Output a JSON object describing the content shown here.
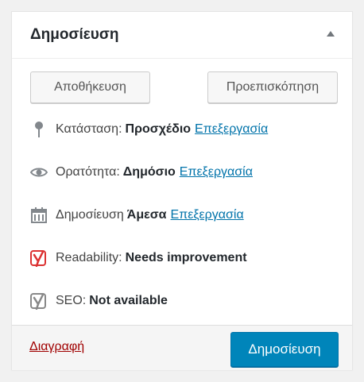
{
  "panel": {
    "title": "Δημοσίευση"
  },
  "actions": {
    "save_label": "Αποθήκευση",
    "preview_label": "Προεπισκόπηση"
  },
  "status": {
    "icon": "pin-icon",
    "label": "Κατάσταση:",
    "value": "Προσχέδιο",
    "edit_label": "Επεξεργασία"
  },
  "visibility": {
    "icon": "eye-icon",
    "label": "Ορατότητα:",
    "value": "Δημόσιο",
    "edit_label": "Επεξεργασία"
  },
  "publish_time": {
    "icon": "calendar-icon",
    "label": "Δημοσίευση",
    "value": "Άμεσα",
    "edit_label": "Επεξεργασία"
  },
  "readability": {
    "icon": "yoast-red-icon",
    "label": "Readability:",
    "value": "Needs improvement",
    "color": "#dc3232"
  },
  "seo": {
    "icon": "yoast-gray-icon",
    "label": "SEO:",
    "value": "Not available",
    "color": "#888888"
  },
  "footer": {
    "delete_label": "Διαγραφή",
    "publish_label": "Δημοσίευση"
  },
  "colors": {
    "primary": "#0085ba",
    "link": "#0073aa",
    "delete": "#a00000"
  }
}
